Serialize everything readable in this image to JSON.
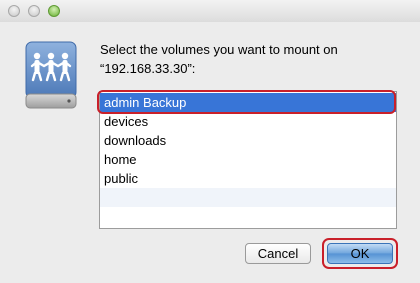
{
  "window": {
    "traffic_lights": [
      "close",
      "minimize",
      "zoom"
    ]
  },
  "dialog": {
    "icon": "network-volume-icon",
    "prompt_line1": "Select the volumes you want to mount on",
    "prompt_line2": "“192.168.33.30”:",
    "volumes": [
      {
        "label": "admin Backup",
        "selected": true
      },
      {
        "label": "devices",
        "selected": false
      },
      {
        "label": "downloads",
        "selected": false
      },
      {
        "label": "home",
        "selected": false
      },
      {
        "label": "public",
        "selected": false
      }
    ],
    "cancel_label": "Cancel",
    "ok_label": "OK"
  },
  "colors": {
    "selection": "#3875d7",
    "highlight_ring": "#c9202a",
    "default_button": "#5592d4"
  }
}
